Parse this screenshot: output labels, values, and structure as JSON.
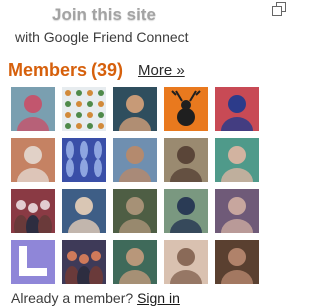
{
  "header": {
    "join_label": "Join this site",
    "caption": "with Google Friend Connect"
  },
  "members": {
    "title": "Members",
    "count": "(39)",
    "more_label": "More »",
    "avatars": [
      {
        "bg": "#7a9fb0",
        "fg": "#c2566e",
        "icon": "person-photo"
      },
      {
        "bg": "#e7ecef",
        "fg": "#4f8a4a",
        "icon": "pattern-photo"
      },
      {
        "bg": "#2f4e5e",
        "fg": "#c79a77",
        "icon": "person-photo"
      },
      {
        "bg": "#e9791e",
        "fg": "#1f1f1f",
        "icon": "deer-photo"
      },
      {
        "bg": "#c84a55",
        "fg": "#2c3b8a",
        "icon": "person-photo"
      },
      {
        "bg": "#c58263",
        "fg": "#e1d1c7",
        "icon": "person-photo"
      },
      {
        "bg": "#3a4fa8",
        "fg": "#8ea5e0",
        "icon": "flower-photo"
      },
      {
        "bg": "#6f8fb0",
        "fg": "#b48a6e",
        "icon": "person-photo"
      },
      {
        "bg": "#9a8a70",
        "fg": "#5a4538",
        "icon": "person-photo"
      },
      {
        "bg": "#4f9a8a",
        "fg": "#d2b3a0",
        "icon": "person-photo"
      },
      {
        "bg": "#8a3a44",
        "fg": "#e2ccd0",
        "icon": "group-photo"
      },
      {
        "bg": "#3e5e86",
        "fg": "#d9c6b4",
        "icon": "person-photo"
      },
      {
        "bg": "#4e5e44",
        "fg": "#a69176",
        "icon": "person-photo"
      },
      {
        "bg": "#7a9880",
        "fg": "#2a3b55",
        "icon": "person-photo"
      },
      {
        "bg": "#6f5a78",
        "fg": "#c7a69e",
        "icon": "person-photo"
      },
      {
        "bg": "#8f86d8",
        "fg": "#ffffff",
        "icon": "default-avatar"
      },
      {
        "bg": "#3e3a58",
        "fg": "#d07a5a",
        "icon": "group-photo"
      },
      {
        "bg": "#3f6a5a",
        "fg": "#b8977a",
        "icon": "person-photo"
      },
      {
        "bg": "#d9c1b0",
        "fg": "#8a6a58",
        "icon": "person-photo"
      },
      {
        "bg": "#5a4030",
        "fg": "#b0826a",
        "icon": "person-photo"
      }
    ]
  },
  "footer": {
    "prompt": "Already a member?",
    "signin_label": "Sign in"
  },
  "colors": {
    "accent": "#d6600c",
    "join_text": "#a3a3a3",
    "body_text": "#3c3c3c"
  }
}
